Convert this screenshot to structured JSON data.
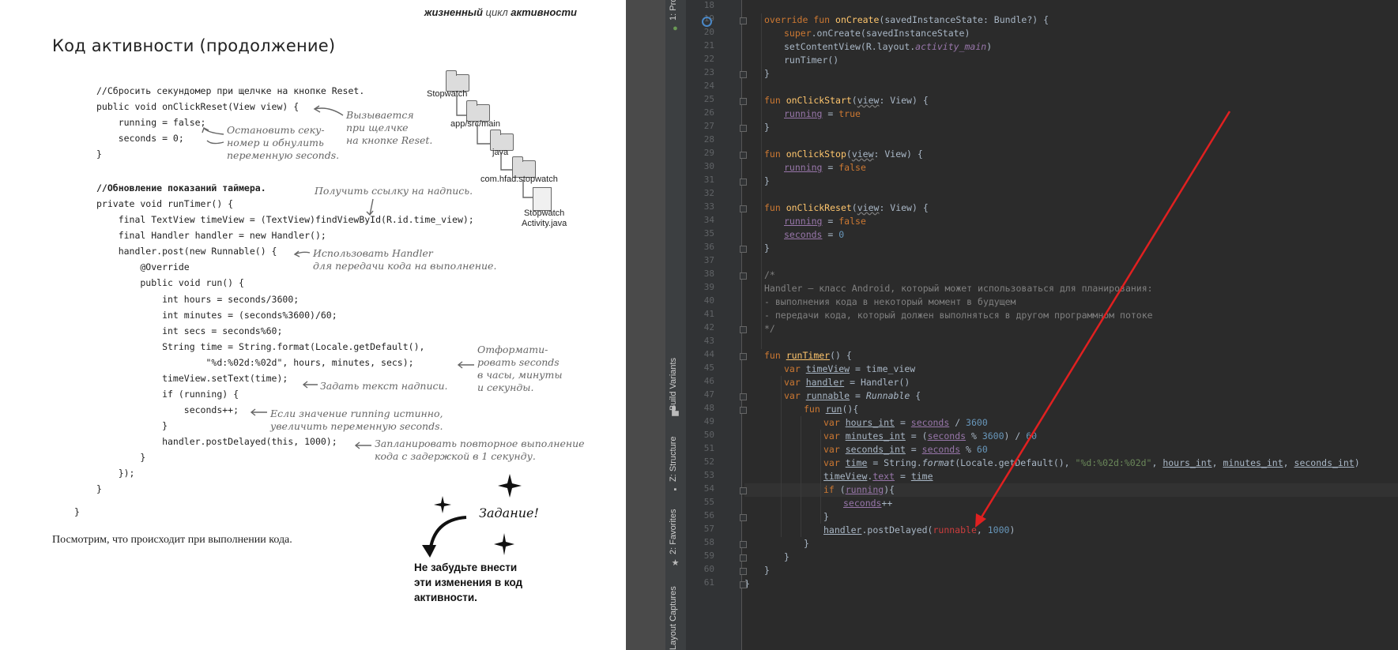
{
  "book": {
    "header_bold1": "жизненный",
    "header_mid": "цикл",
    "header_bold2": "активности",
    "title": "Код активности (продолжение)",
    "code_reset": [
      "//Сбросить секундомер при щелчке на кнопке Reset.",
      "public void onClickReset(View view) {",
      "    running = false;",
      "    seconds = 0;",
      "}"
    ],
    "code_timer_comment": "//Обновление показаний таймера.",
    "code_timer": [
      "private void runTimer() {",
      "    final TextView timeView = (TextView)findViewById(R.id.time_view);",
      "    final Handler handler = new Handler();",
      "    handler.post(new Runnable() {",
      "        @Override",
      "        public void run() {",
      "            int hours = seconds/3600;",
      "            int minutes = (seconds%3600)/60;",
      "            int secs = seconds%60;",
      "            String time = String.format(Locale.getDefault(),",
      "                    \"%d:%02d:%02d\", hours, minutes, secs);",
      "            timeView.setText(time);",
      "            if (running) {",
      "                seconds++;",
      "            }",
      "            handler.postDelayed(this, 1000);",
      "        }",
      "    });",
      "}"
    ],
    "code_close": "}",
    "notes": {
      "called": "Вызывается\nпри щелчке\nна кнопке Reset.",
      "stop": "Остановить секу-\nномер и обнулить\nпеременную seconds.",
      "getref": "Получить ссылку на надпись.",
      "handler": "Использовать Handler\nдля передачи кода на выполнение.",
      "format": "Отформати-\nровать seconds\nв часы, минуты\nи секунды.",
      "settext": "Задать текст надписи.",
      "increment": "Если значение running истинно,\nувеличить переменную seconds.",
      "schedule": "Запланировать повторное выполнение\nкода с задержкой в 1 секунду."
    },
    "tree": {
      "root": "Stopwatch",
      "src": "app/src/main",
      "java": "java",
      "pkg": "com.hfad.stopwatch",
      "file": "Stopwatch\nActivity.java"
    },
    "body_text": "Посмотрим, что происходит при выполнении кода.",
    "task_word": "Задание!",
    "task_text": "Не забудьте внести\nэти изменения в код\nактивности."
  },
  "ide": {
    "tool_tabs": [
      "1: Pro",
      "Build Variants",
      "Z: Structure",
      "2: Favorites",
      "Layout Captures"
    ],
    "line_numbers": [
      "18",
      "19",
      "20",
      "21",
      "22",
      "23",
      "24",
      "25",
      "26",
      "27",
      "28",
      "29",
      "30",
      "31",
      "32",
      "33",
      "34",
      "35",
      "36",
      "37",
      "38",
      "39",
      "40",
      "41",
      "42",
      "43",
      "44",
      "45",
      "46",
      "47",
      "48",
      "49",
      "50",
      "51",
      "52",
      "53",
      "54",
      "55",
      "56",
      "57",
      "58",
      "59",
      "60",
      "61"
    ],
    "code": {
      "l19": [
        "override fun ",
        "onCreate",
        "(savedInstanceState: Bundle?) {"
      ],
      "l20": [
        "super",
        ".onCreate(savedInstanceState)"
      ],
      "l21": [
        "setContentView(R.layout.",
        "activity_main",
        ")"
      ],
      "l22": "runTimer()",
      "l23": "}",
      "l25": [
        "fun ",
        "onClickStart",
        "(",
        "view",
        ": View) {"
      ],
      "l26": [
        "running",
        " = ",
        "true"
      ],
      "l27": "}",
      "l29": [
        "fun ",
        "onClickStop",
        "(",
        "view",
        ": View) {"
      ],
      "l30": [
        "running",
        " = ",
        "false"
      ],
      "l31": "}",
      "l33": [
        "fun ",
        "onClickReset",
        "(",
        "view",
        ": View) {"
      ],
      "l34": [
        "running",
        " = ",
        "false"
      ],
      "l35": [
        "seconds",
        " = ",
        "0"
      ],
      "l36": "}",
      "l38": "/*",
      "l39": "Handler — класс Android, который может использоваться для планирования:",
      "l40": "- выполнения кода в некоторый момент в будущем",
      "l41": "- передачи кода, который должен выполняться в другом программном потоке",
      "l42": "*/",
      "l44": [
        "fun ",
        "runTimer",
        "() {"
      ],
      "l45": [
        "var ",
        "timeView",
        " = time_view"
      ],
      "l46": [
        "var ",
        "handler",
        " = Handler()"
      ],
      "l47": [
        "var ",
        "runnable",
        " = ",
        "Runnable",
        " {"
      ],
      "l48": [
        "fun ",
        "run",
        "(){"
      ],
      "l49": [
        "var ",
        "hours_int",
        " = ",
        "seconds",
        " / ",
        "3600"
      ],
      "l50": [
        "var ",
        "minutes_int",
        " = (",
        "seconds",
        " % ",
        "3600",
        ") / ",
        "60"
      ],
      "l51": [
        "var ",
        "seconds_int",
        " = ",
        "seconds",
        " % ",
        "60"
      ],
      "l52": [
        "var ",
        "time",
        " = String.",
        "format",
        "(Locale.getDefault(), ",
        "\"%d:%02d:%02d\"",
        ", ",
        "hours_int",
        ", ",
        "minutes_int",
        ", ",
        "seconds_int",
        ")"
      ],
      "l53": [
        "timeView",
        ".",
        "text",
        " = ",
        "time"
      ],
      "l54": [
        "if ",
        "(",
        "running",
        "){"
      ],
      "l55": [
        "seconds",
        "++"
      ],
      "l56": "}",
      "l57": [
        "handler",
        ".postDelayed(",
        "runnable",
        ", ",
        "1000",
        ")"
      ],
      "l58": "}",
      "l59": "}",
      "l60": "}",
      "l61": "}"
    }
  },
  "colors": {
    "ide_bg": "#2b2b2b",
    "keyword": "#cc7832",
    "function": "#ffc66d",
    "property": "#9876aa",
    "number": "#6897bb",
    "string": "#6a8759",
    "comment": "#808080",
    "annotation_arrow": "#e02020"
  }
}
